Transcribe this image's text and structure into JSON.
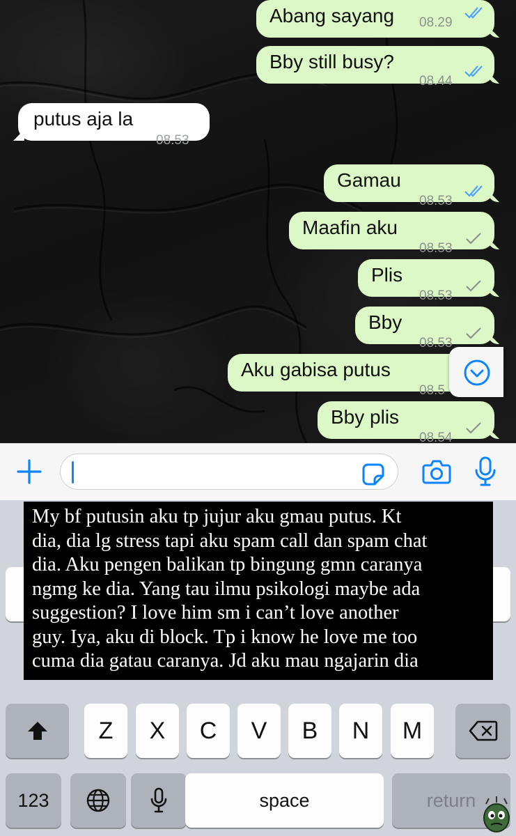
{
  "messages": [
    {
      "dir": "out",
      "text": "Abang sayang",
      "time": "08.29",
      "status": "read"
    },
    {
      "dir": "out",
      "text": "Bby still busy?",
      "time": "08.44",
      "status": "read"
    },
    {
      "dir": "in",
      "text": "putus aja la",
      "time": "08.53",
      "status": ""
    },
    {
      "dir": "out",
      "text": "Gamau",
      "time": "08.53",
      "status": "read"
    },
    {
      "dir": "out",
      "text": "Maafin aku",
      "time": "08.53",
      "status": "sent"
    },
    {
      "dir": "out",
      "text": "Plis",
      "time": "08.53",
      "status": "sent"
    },
    {
      "dir": "out",
      "text": "Bby",
      "time": "08.53",
      "status": "sent"
    },
    {
      "dir": "out",
      "text": "Aku gabisa putus",
      "time": "08.5",
      "status": "sent"
    },
    {
      "dir": "out",
      "text": "Bby plis",
      "time": "08.54",
      "status": "sent"
    }
  ],
  "icons": {
    "scroll_down": "chevron-down-circle-icon",
    "plus": "plus-icon",
    "sticker": "sticker-icon",
    "camera": "camera-icon",
    "mic": "microphone-icon"
  },
  "composer": {
    "value": ""
  },
  "overlay_lines": [
    "My bf putusin aku tp jujur aku gmau putus. Kt",
    "dia, dia lg stress tapi aku spam call dan spam chat",
    "dia. Aku pengen balikan tp bingung gmn caranya",
    "ngmg ke dia. Yang tau ilmu psikologi maybe ada",
    "suggestion? I love him sm i can’t love another",
    "guy. Iya, aku di block. Tp i know he love me too",
    "cuma dia gatau caranya. Jd aku mau ngajarin dia"
  ],
  "keyboard": {
    "row3": [
      "Z",
      "X",
      "C",
      "V",
      "B",
      "N",
      "M"
    ],
    "num_label": "123",
    "space_label": "space",
    "return_label": "return"
  },
  "colors": {
    "outgoing_bubble": "#dcf8c6",
    "incoming_bubble": "#ffffff",
    "read_ticks": "#4fa3f7",
    "accent": "#0a84ff"
  }
}
